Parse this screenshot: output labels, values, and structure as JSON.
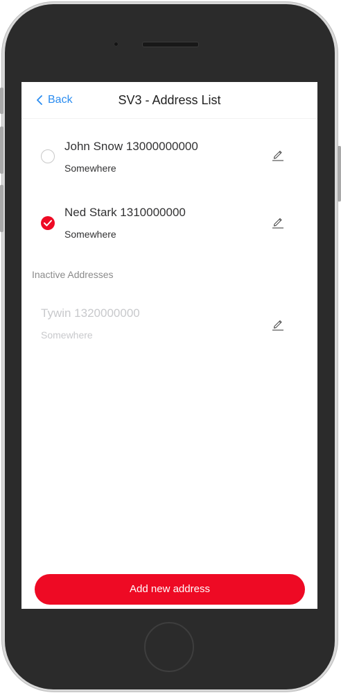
{
  "nav": {
    "back_label": "Back",
    "title": "SV3 - Address List"
  },
  "active_addresses": [
    {
      "name_line": "John Snow 13000000000",
      "location": "Somewhere",
      "selected": false
    },
    {
      "name_line": "Ned Stark 1310000000",
      "location": "Somewhere",
      "selected": true
    }
  ],
  "inactive_section_label": "Inactive Addresses",
  "inactive_addresses": [
    {
      "name_line": "Tywin 1320000000",
      "location": "Somewhere"
    }
  ],
  "add_button_label": "Add new address",
  "colors": {
    "accent": "#ee0a24",
    "link": "#2a8cf0",
    "inactive_text": "#c8c9cc",
    "section_label": "#8a8a8a"
  },
  "icons": {
    "back": "chevron-left-icon",
    "edit": "pencil-icon",
    "selected": "check-icon"
  }
}
